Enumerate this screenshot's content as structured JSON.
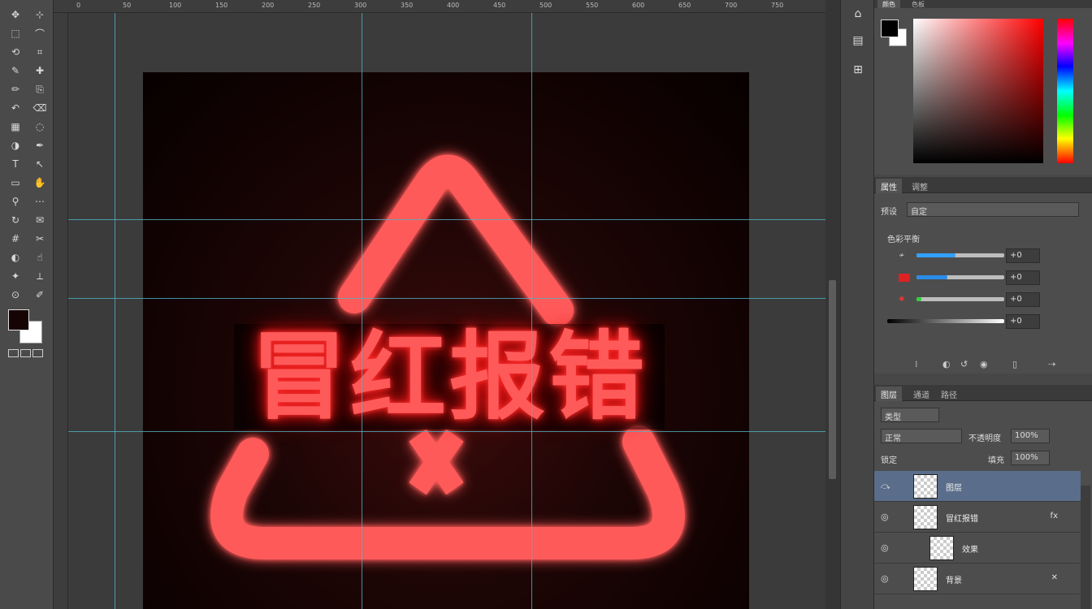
{
  "canvas": {
    "headline": "冒红报错",
    "background_color": "#0a0000",
    "neon_color": "#ff5a5a"
  },
  "ruler_top": [
    "0",
    "50",
    "100",
    "150",
    "200",
    "250",
    "300",
    "350",
    "400",
    "450",
    "500",
    "550",
    "600",
    "650",
    "700",
    "750"
  ],
  "toolbar": {
    "tools": [
      "move-tool",
      "artboard-tool",
      "marquee-tool",
      "lasso-tool",
      "quick-select-tool",
      "crop-tool",
      "eyedropper-tool",
      "healing-tool",
      "brush-tool",
      "clone-stamp-tool",
      "history-brush-tool",
      "eraser-tool",
      "gradient-tool",
      "blur-tool",
      "dodge-tool",
      "pen-tool",
      "type-tool",
      "path-select-tool",
      "shape-tool",
      "hand-tool",
      "zoom-tool",
      "edit-toolbar-tool",
      "rotate-view-tool",
      "note-tool",
      "count-tool",
      "slice-tool",
      "sponge-tool",
      "smudge-tool",
      "magic-wand-tool",
      "ruler-tool",
      "color-sampler-tool",
      "mixer-brush-tool"
    ],
    "foreground_color": "#160404",
    "background_color": "#ffffff"
  },
  "dock": {
    "items": [
      "history-icon",
      "properties-icon",
      "libraries-icon"
    ]
  },
  "color_panel": {
    "tabs": [
      "颜色",
      "色板"
    ],
    "foreground": "#000000",
    "background": "#ffffff",
    "hue": "#ff0000"
  },
  "adjustments_panel": {
    "tabs": [
      "属性",
      "调整"
    ],
    "preset_label": "预设",
    "preset_value": "自定",
    "section_title": "色彩平衡",
    "channels": [
      {
        "name": "cyan-red",
        "color": "#33a0ff",
        "fill": 0.45,
        "value": "+0"
      },
      {
        "name": "magenta-green",
        "color": "#2b8ce8",
        "fill": 0.3,
        "value": "+0"
      },
      {
        "name": "yellow-blue",
        "color": "#2fcf3a",
        "fill": 0.02,
        "value": "+0"
      },
      {
        "name": "tone",
        "color": "#ffffff",
        "fill": 1.0,
        "value": "+0"
      }
    ]
  },
  "layers_panel": {
    "tabs": [
      "图层",
      "通道",
      "路径"
    ],
    "kind_filter": "类型",
    "blend_mode": "正常",
    "opacity_label": "不透明度",
    "opacity_value": "100%",
    "fill_label": "填充",
    "fill_value": "100%",
    "lock_label": "锁定",
    "layers": [
      {
        "name": "图层",
        "selected": true,
        "visible": false,
        "extra": ""
      },
      {
        "name": "冒红报错",
        "selected": false,
        "visible": true,
        "extra": "fx"
      },
      {
        "name": "效果",
        "selected": false,
        "visible": true,
        "extra": ""
      },
      {
        "name": "背景",
        "selected": false,
        "visible": true,
        "extra": "✕"
      }
    ]
  }
}
